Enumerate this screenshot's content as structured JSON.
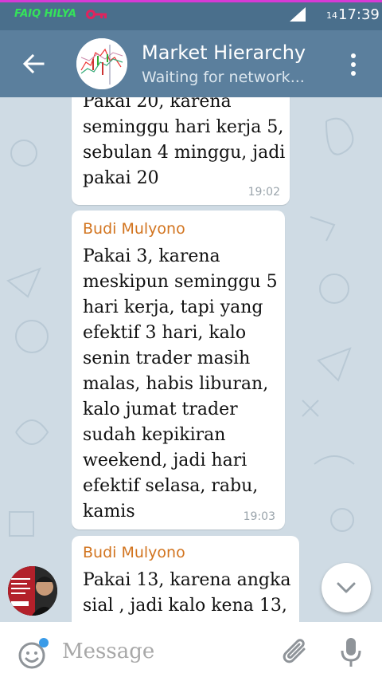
{
  "status_bar": {
    "carrier": "FAIQ HILYA",
    "badge": "14",
    "time": "17:39"
  },
  "header": {
    "title": "Market Hierarchy",
    "subtitle": "Waiting for network..."
  },
  "messages": [
    {
      "sender": "",
      "text": "Pakai 20, karena\nseminggu hari kerja 5,\nsebulan 4 minggu, jadi\npakai 20",
      "time": "19:02"
    },
    {
      "sender": "Budi Mulyono",
      "text": "Pakai 3, karena\nmeskipun seminggu 5\nhari kerja, tapi yang\nefektif 3 hari, kalo\nsenin trader masih\nmalas, habis liburan,\nkalo jumat trader\nsudah kepikiran\nweekend, jadi hari\nefektif selasa, rabu,\nkamis",
      "time": "19:03"
    },
    {
      "sender": "Budi Mulyono",
      "text": "Pakai 13, karena angka\nsial , jadi kalo kena 13,",
      "time": ""
    }
  ],
  "composer": {
    "placeholder": "Message"
  },
  "colors": {
    "status_bar": "#4a6f8c",
    "header": "#5b7f9d",
    "sender_name": "#d2741f",
    "chat_background": "#cfdbe4",
    "carrier_text": "#35e35a"
  },
  "icons": [
    "key-icon",
    "signal-icon",
    "back-icon",
    "menu-icon",
    "chevron-down-icon",
    "emoji-icon",
    "attach-icon",
    "mic-icon"
  ]
}
